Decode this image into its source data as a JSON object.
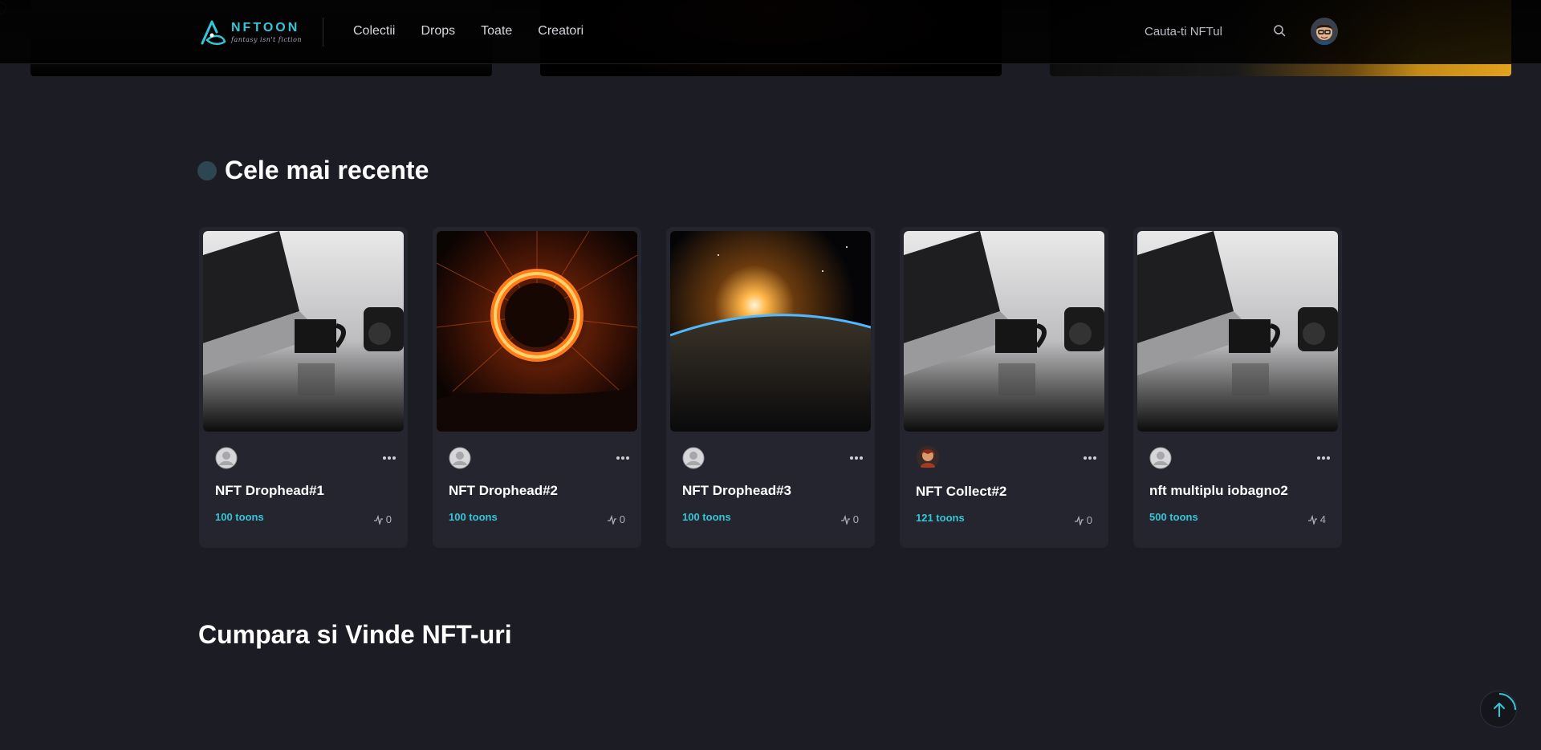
{
  "header": {
    "logo": {
      "name": "NFTOON",
      "tagline": "fantasy isn't fiction"
    },
    "nav": [
      {
        "label": "Colectii"
      },
      {
        "label": "Drops"
      },
      {
        "label": "Toate"
      },
      {
        "label": "Creatori"
      }
    ],
    "search_placeholder": "Cauta-ti NFTul",
    "search_icon": "search-icon",
    "user_avatar_icon": "user-avatar"
  },
  "recent": {
    "title": "Cele mai recente",
    "cards": [
      {
        "name": "NFT Drophead#1",
        "price": "100 toons",
        "activity": "0",
        "image": "laptop-coffee-camera",
        "owner": "default-avatar"
      },
      {
        "name": "NFT Drophead#2",
        "price": "100 toons",
        "activity": "0",
        "image": "fire-ring-sparks",
        "owner": "default-avatar"
      },
      {
        "name": "NFT Drophead#3",
        "price": "100 toons",
        "activity": "0",
        "image": "earth-sunrise-space",
        "owner": "default-avatar"
      },
      {
        "name": "NFT Collect#2",
        "price": "121 toons",
        "activity": "0",
        "image": "laptop-coffee-camera",
        "owner": "illustrated-avatar"
      },
      {
        "name": "nft multiplu iobagno2",
        "price": "500 toons",
        "activity": "4",
        "image": "laptop-coffee-camera",
        "owner": "default-avatar"
      }
    ]
  },
  "buy_sell": {
    "title": "Cumpara si Vinde NFT-uri"
  },
  "colors": {
    "accent": "#33c6d8",
    "background": "#1c1c24",
    "card": "#25252f"
  }
}
